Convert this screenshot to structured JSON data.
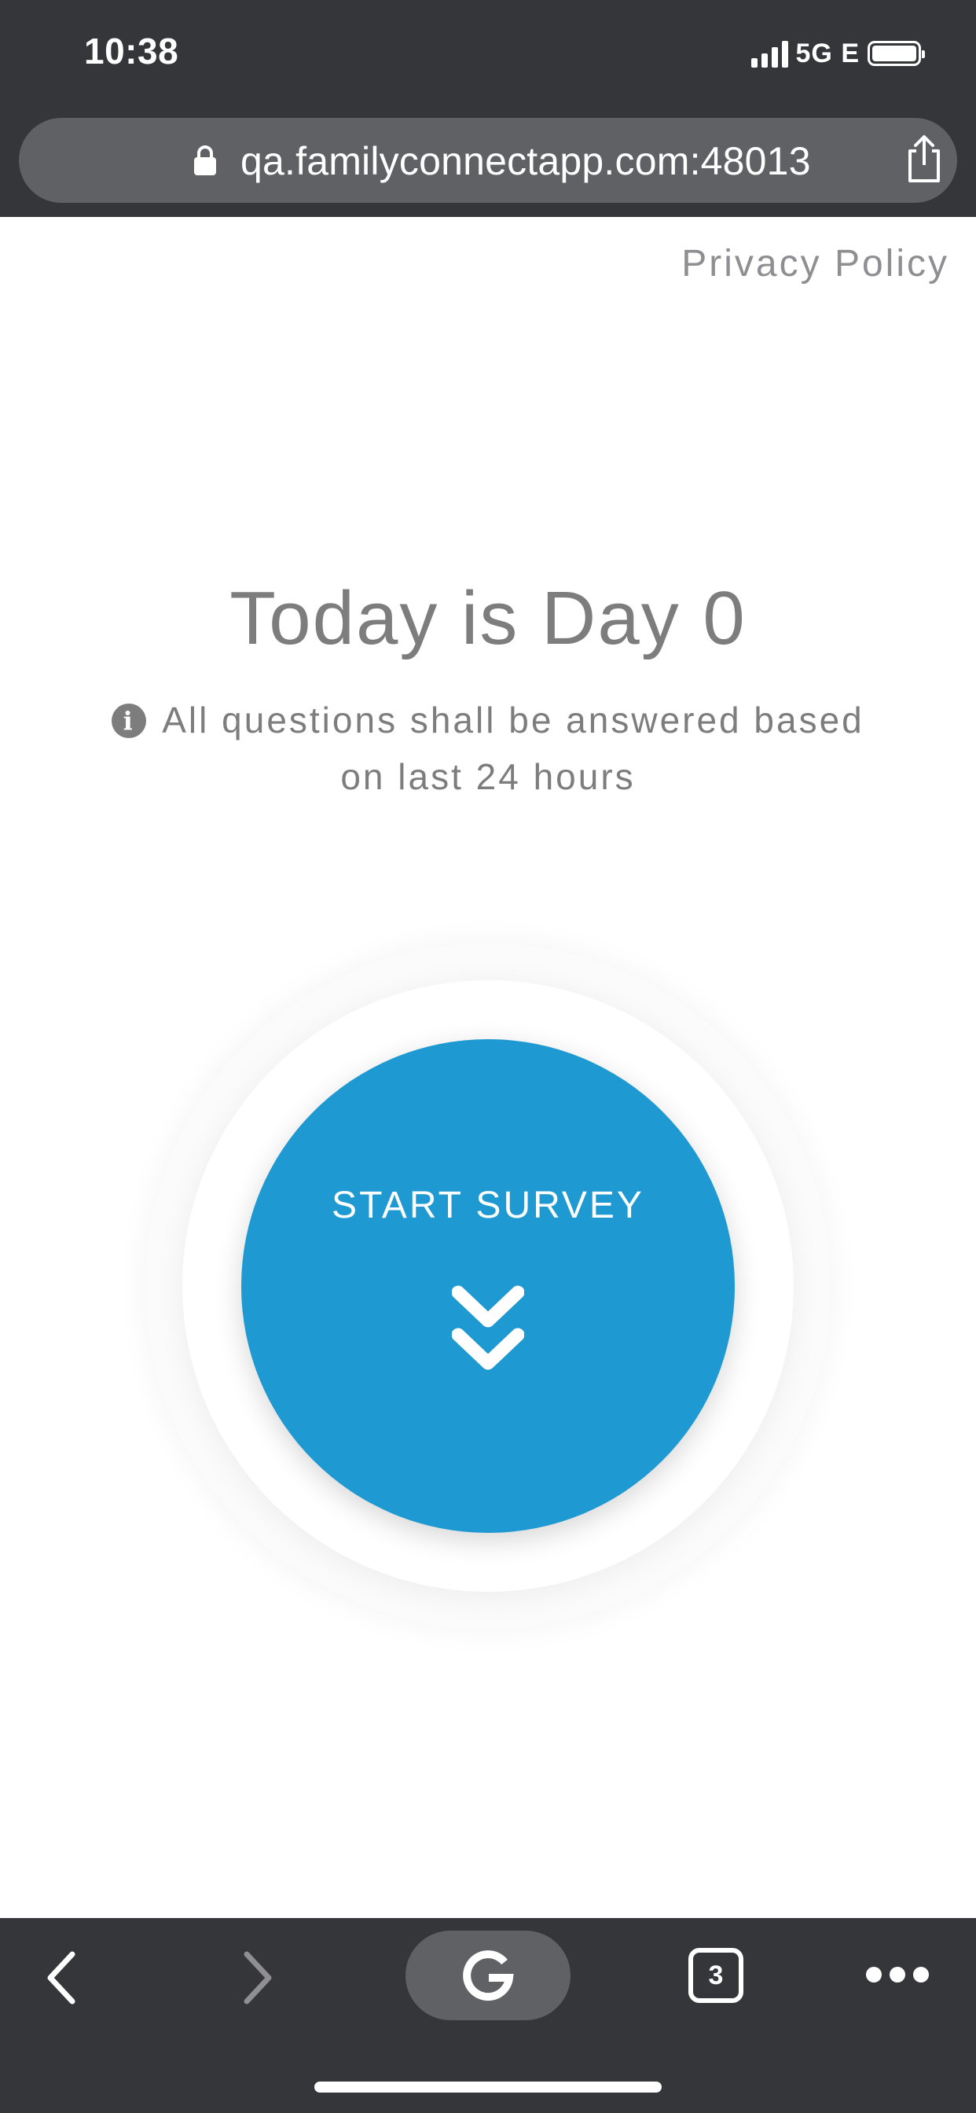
{
  "status_bar": {
    "time": "10:38",
    "network": "5G E"
  },
  "browser": {
    "url": "qa.familyconnectapp.com:48013",
    "tab_count": "3"
  },
  "page": {
    "privacy_link": "Privacy Policy",
    "day_title": "Today is Day 0",
    "info_line_1": "All questions shall be answered based",
    "info_line_2": "on last 24 hours",
    "start_button_label": "START SURVEY"
  },
  "icons": {
    "lock": "lock-icon",
    "share": "share-icon",
    "info": "info-icon",
    "chevrons": "double-chevron-down-icon",
    "back": "back-arrow-icon",
    "forward": "forward-arrow-icon",
    "google": "google-icon",
    "more": "more-icon"
  },
  "colors": {
    "chrome_dark": "#35363a",
    "url_pill": "#5f6165",
    "accent_blue": "#1e99d1",
    "text_gray": "#7d7d7d"
  }
}
